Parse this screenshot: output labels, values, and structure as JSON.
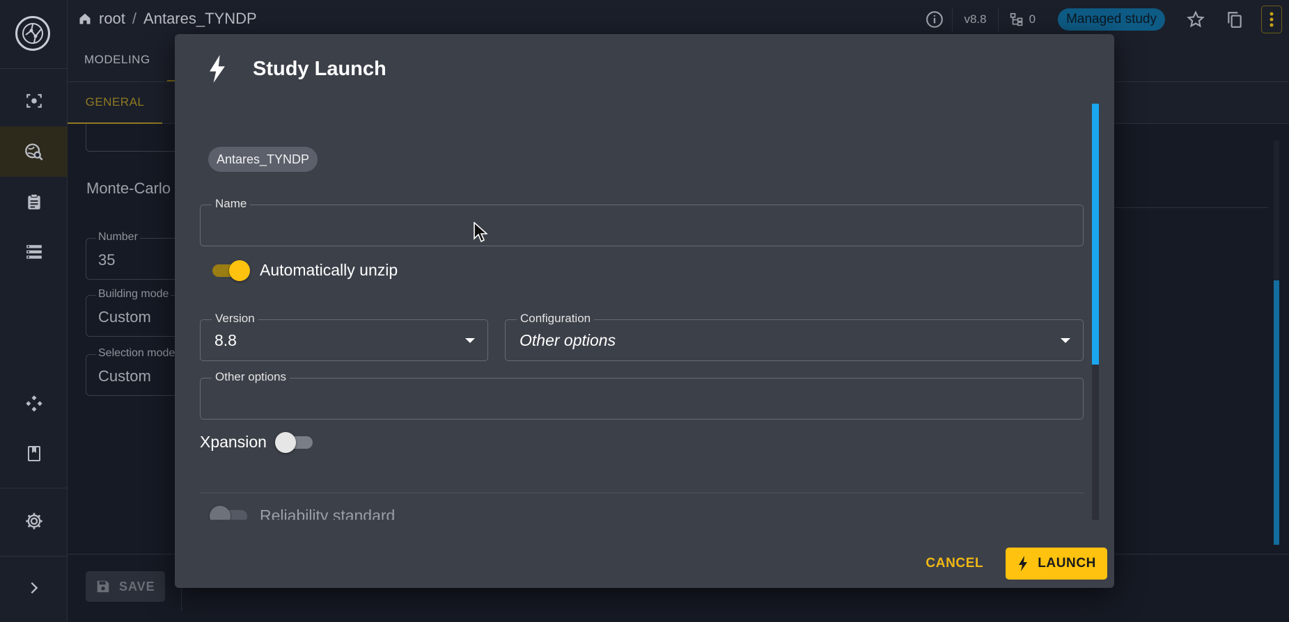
{
  "app": {
    "breadcrumb": {
      "root": "root",
      "separator": "/",
      "study": "Antares_TYNDP"
    },
    "version_badge": "v8.8",
    "variants_count": "0",
    "managed_badge": "Managed study",
    "tabs": {
      "primary": "MODELING",
      "secondary": "GENERAL"
    },
    "background": {
      "section_title": "Monte-Carlo",
      "fields": [
        {
          "label": "Number",
          "value": "35"
        },
        {
          "label": "Building mode",
          "value": "Custom"
        },
        {
          "label": "Selection mode",
          "value": "Custom"
        }
      ],
      "save_label": "SAVE"
    },
    "icons": {
      "logo": "antares-logo-icon",
      "sidebar": [
        "studies-icon",
        "explore-icon",
        "tasks-icon",
        "data-icon",
        "api-icon",
        "docs-icon",
        "settings-icon",
        "expand-icon"
      ]
    },
    "accent_color": "#ffc20e"
  },
  "dialog": {
    "title": "Study Launch",
    "study_chip": "Antares_TYNDP",
    "name_field": {
      "label": "Name",
      "value": ""
    },
    "auto_unzip": {
      "label": "Automatically unzip",
      "checked": true
    },
    "version_field": {
      "label": "Version",
      "value": "8.8"
    },
    "configuration_field": {
      "label": "Configuration",
      "value": "Other options"
    },
    "other_options_field": {
      "label": "Other options",
      "value": ""
    },
    "xpansion": {
      "label": "Xpansion",
      "checked": false
    },
    "reliability": {
      "label": "Reliability standard",
      "checked": false,
      "disabled": true
    },
    "cancel_label": "CANCEL",
    "launch_label": "LAUNCH"
  }
}
